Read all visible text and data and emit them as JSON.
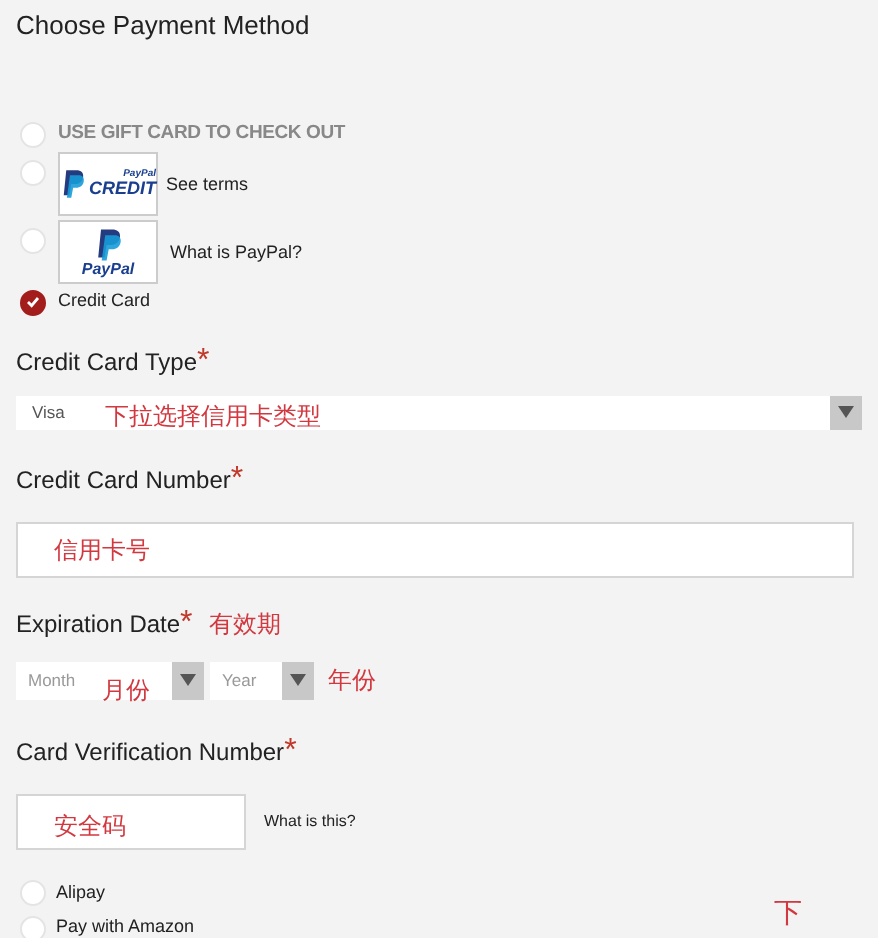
{
  "title": "Choose Payment Method",
  "payment_options": [
    {
      "kind": "text",
      "label": "USE GIFT CARD TO CHECK OUT",
      "selected": false
    },
    {
      "kind": "credit-logo",
      "logo_lines": [
        "PayPal",
        "CREDIT"
      ],
      "label": "See terms",
      "selected": false
    },
    {
      "kind": "paypal-logo",
      "logo_lines": [
        "PayPal"
      ],
      "label": "What is PayPal?",
      "selected": false
    },
    {
      "kind": "text",
      "label": "Credit Card",
      "selected": true
    }
  ],
  "card_type": {
    "label": "Credit Card Type",
    "required_mark": "*",
    "value": "Visa",
    "annotation": "下拉选择信用卡类型"
  },
  "card_number": {
    "label": "Credit Card Number",
    "required_mark": "*",
    "annotation": "信用卡号"
  },
  "expiration": {
    "label": "Expiration Date",
    "required_mark": "*",
    "annotation": "有效期",
    "month": {
      "placeholder": "Month",
      "annotation": "月份"
    },
    "year": {
      "placeholder": "Year",
      "annotation": "年份"
    }
  },
  "cvv": {
    "label": "Card Verification Number",
    "required_mark": "*",
    "annotation": "安全码",
    "help_link": "What is this?"
  },
  "other_options": [
    {
      "label": "Alipay",
      "selected": false
    },
    {
      "label": "Pay with Amazon",
      "selected": false
    }
  ],
  "footer_annotation": "下"
}
